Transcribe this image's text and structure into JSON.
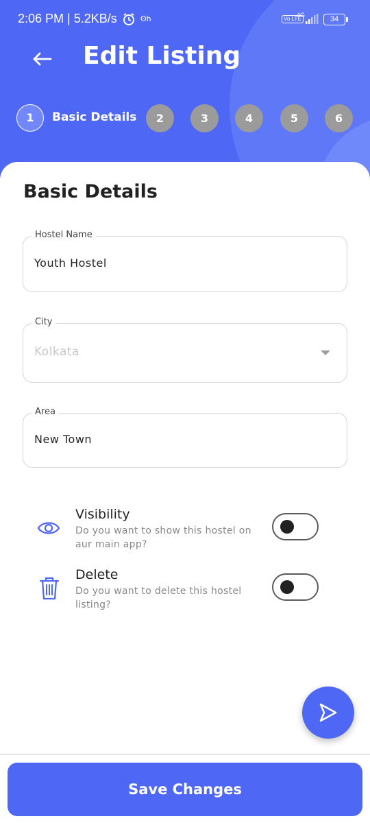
{
  "status_bar": {
    "time": "2:06 PM | 5.2KB/s",
    "extra": "ʘh",
    "lte": "Vo LTE",
    "network": "4G",
    "battery": "34"
  },
  "header": {
    "title": "Edit Listing",
    "steps": [
      {
        "number": "1",
        "label": "Basic Details"
      },
      {
        "number": "2"
      },
      {
        "number": "3"
      },
      {
        "number": "4"
      },
      {
        "number": "5"
      },
      {
        "number": "6"
      }
    ]
  },
  "form": {
    "section_title": "Basic Details",
    "hostel_name": {
      "label": "Hostel Name",
      "value": "Youth Hostel"
    },
    "city": {
      "label": "City",
      "value": "Kolkata"
    },
    "area": {
      "label": "Area",
      "value": "New Town"
    }
  },
  "options": {
    "visibility": {
      "title": "Visibility",
      "description": "Do you want to show this hostel on aur main app?",
      "enabled": false
    },
    "delete": {
      "title": "Delete",
      "description": "Do you want to delete this hostel listing?",
      "enabled": false
    }
  },
  "actions": {
    "save_label": "Save Changes"
  },
  "colors": {
    "primary": "#4f67f5",
    "step_inactive": "#9b9b9b"
  }
}
